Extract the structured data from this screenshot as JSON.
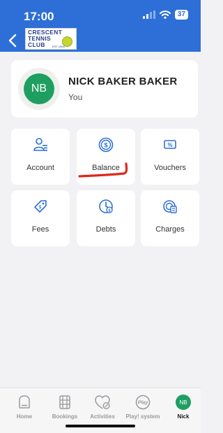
{
  "status_bar": {
    "time": "17:00",
    "battery": "37"
  },
  "header": {
    "logo_text_lines": [
      "CRESCENT",
      "TENNIS",
      "CLUB"
    ],
    "logo_est": "EST 1905"
  },
  "profile": {
    "initials": "NB",
    "name": "NICK BAKER BAKER",
    "subtitle": "You"
  },
  "menu": [
    {
      "key": "account",
      "label": "Account",
      "icon": "account-icon"
    },
    {
      "key": "balance",
      "label": "Balance",
      "icon": "balance-icon"
    },
    {
      "key": "vouchers",
      "label": "Vouchers",
      "icon": "vouchers-icon"
    },
    {
      "key": "fees",
      "label": "Fees",
      "icon": "fees-icon"
    },
    {
      "key": "debts",
      "label": "Debts",
      "icon": "debts-icon"
    },
    {
      "key": "charges",
      "label": "Charges",
      "icon": "charges-icon"
    }
  ],
  "annotation": {
    "color": "#e0261b"
  },
  "tabbar": {
    "items": [
      {
        "label": "Home",
        "icon": "home-icon"
      },
      {
        "label": "Bookings",
        "icon": "bookings-icon"
      },
      {
        "label": "Activities",
        "icon": "activities-icon"
      },
      {
        "label": "Play! system",
        "icon": "play-system-icon",
        "icon_text": "Play"
      },
      {
        "label": "Nick",
        "icon": "avatar",
        "initials": "NB",
        "active": true
      }
    ]
  },
  "colors": {
    "header": "#2d6fd6",
    "avatar": "#1e9f61",
    "background": "#f2f2f4"
  }
}
